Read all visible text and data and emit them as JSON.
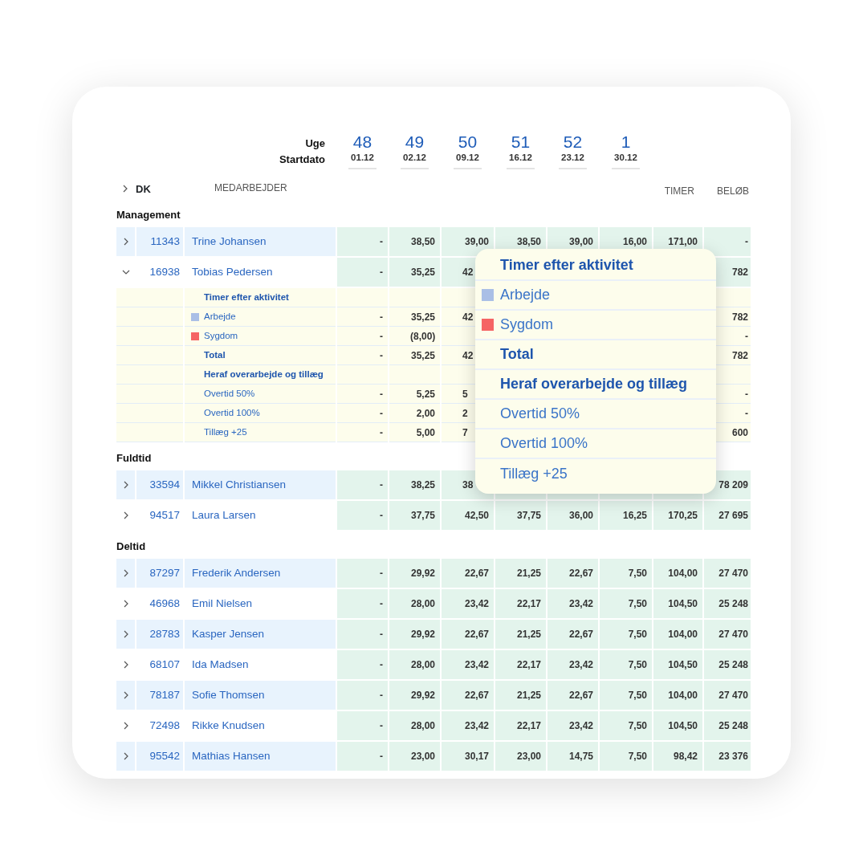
{
  "header": {
    "week_label": "Uge",
    "date_label": "Startdato",
    "weeks": [
      {
        "number": "48",
        "date": "01.12"
      },
      {
        "number": "49",
        "date": "02.12"
      },
      {
        "number": "50",
        "date": "09.12"
      },
      {
        "number": "51",
        "date": "16.12"
      },
      {
        "number": "52",
        "date": "23.12"
      },
      {
        "number": "1",
        "date": "30.12"
      }
    ]
  },
  "columns": {
    "region": "DK",
    "employee": "MEDARBEJDER",
    "hours": "TIMER",
    "amount": "BELØB"
  },
  "groups": [
    {
      "name": "Management",
      "rows": [
        {
          "id": "11343",
          "name": "Trine Johansen",
          "expanded": false,
          "weeks": [
            "-",
            "38,50",
            "39,00",
            "38,50",
            "39,00",
            "16,00"
          ],
          "hours": "171,00",
          "amount": "-"
        },
        {
          "id": "16938",
          "name": "Tobias Pedersen",
          "expanded": true,
          "weeks": [
            "-",
            "35,25",
            "42"
          ],
          "amount": "782",
          "details": [
            {
              "kind": "heading",
              "label": "Timer efter aktivitet"
            },
            {
              "kind": "activity",
              "label": "Arbejde",
              "color": "#aabfe6",
              "weeks": [
                "-",
                "35,25",
                "42"
              ],
              "amount": "782"
            },
            {
              "kind": "activity",
              "label": "Sygdom",
              "color": "#f56464",
              "weeks": [
                "-",
                "(8,00)"
              ],
              "amount": "-"
            },
            {
              "kind": "total",
              "label": "Total",
              "weeks": [
                "-",
                "35,25",
                "42"
              ],
              "amount": "782"
            },
            {
              "kind": "heading",
              "label": "Heraf overarbejde og tillæg"
            },
            {
              "kind": "item",
              "label": "Overtid 50%",
              "weeks": [
                "-",
                "5,25",
                "5"
              ],
              "amount": "-"
            },
            {
              "kind": "item",
              "label": "Overtid 100%",
              "weeks": [
                "-",
                "2,00",
                "2"
              ],
              "amount": "-"
            },
            {
              "kind": "item",
              "label": "Tillæg +25",
              "weeks": [
                "-",
                "5,00",
                "7"
              ],
              "amount": "600"
            }
          ]
        }
      ]
    },
    {
      "name": "Fuldtid",
      "rows": [
        {
          "id": "33594",
          "name": "Mikkel Christiansen",
          "expanded": false,
          "weeks": [
            "-",
            "38,25",
            "38"
          ],
          "amount": "78 209"
        },
        {
          "id": "94517",
          "name": "Laura Larsen",
          "expanded": false,
          "weeks": [
            "-",
            "37,75",
            "42,50",
            "37,75",
            "36,00",
            "16,25"
          ],
          "hours": "170,25",
          "amount": "27 695"
        }
      ]
    },
    {
      "name": "Deltid",
      "rows": [
        {
          "id": "87297",
          "name": "Frederik Andersen",
          "expanded": false,
          "weeks": [
            "-",
            "29,92",
            "22,67",
            "21,25",
            "22,67",
            "7,50"
          ],
          "hours": "104,00",
          "amount": "27 470"
        },
        {
          "id": "46968",
          "name": "Emil Nielsen",
          "expanded": false,
          "weeks": [
            "-",
            "28,00",
            "23,42",
            "22,17",
            "23,42",
            "7,50"
          ],
          "hours": "104,50",
          "amount": "25 248"
        },
        {
          "id": "28783",
          "name": "Kasper Jensen",
          "expanded": false,
          "weeks": [
            "-",
            "29,92",
            "22,67",
            "21,25",
            "22,67",
            "7,50"
          ],
          "hours": "104,00",
          "amount": "27 470"
        },
        {
          "id": "68107",
          "name": "Ida Madsen",
          "expanded": false,
          "weeks": [
            "-",
            "28,00",
            "23,42",
            "22,17",
            "23,42",
            "7,50"
          ],
          "hours": "104,50",
          "amount": "25 248"
        },
        {
          "id": "78187",
          "name": "Sofie Thomsen",
          "expanded": false,
          "weeks": [
            "-",
            "29,92",
            "22,67",
            "21,25",
            "22,67",
            "7,50"
          ],
          "hours": "104,00",
          "amount": "27 470"
        },
        {
          "id": "72498",
          "name": "Rikke Knudsen",
          "expanded": false,
          "weeks": [
            "-",
            "28,00",
            "23,42",
            "22,17",
            "23,42",
            "7,50"
          ],
          "hours": "104,50",
          "amount": "25 248"
        },
        {
          "id": "95542",
          "name": "Mathias Hansen",
          "expanded": false,
          "weeks": [
            "-",
            "23,00",
            "30,17",
            "23,00",
            "14,75",
            "7,50"
          ],
          "hours": "98,42",
          "amount": "23 376"
        }
      ]
    }
  ],
  "popup": {
    "items": [
      {
        "kind": "heading",
        "label": "Timer efter aktivitet"
      },
      {
        "kind": "activity",
        "label": "Arbejde",
        "color": "#aabfe6"
      },
      {
        "kind": "activity",
        "label": "Sygdom",
        "color": "#f56464"
      },
      {
        "kind": "total",
        "label": "Total"
      },
      {
        "kind": "heading",
        "label": "Heraf overarbejde og tillæg"
      },
      {
        "kind": "item",
        "label": "Overtid 50%"
      },
      {
        "kind": "item",
        "label": "Overtid 100%"
      },
      {
        "kind": "item",
        "label": "Tillæg +25"
      }
    ]
  }
}
